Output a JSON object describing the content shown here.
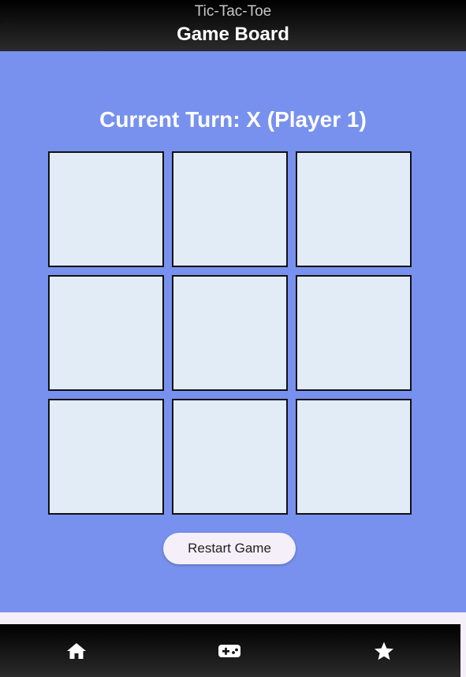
{
  "app_bar": {
    "subtitle": "Tic-Tac-Toe",
    "title": "Game Board"
  },
  "game": {
    "status": "Current Turn: X (Player 1)",
    "board": [
      "",
      "",
      "",
      "",
      "",
      "",
      "",
      "",
      ""
    ],
    "restart_label": "Restart Game"
  },
  "bottom_nav": {
    "items": [
      {
        "icon": "home-icon"
      },
      {
        "icon": "gamepad-icon"
      },
      {
        "icon": "star-icon"
      }
    ]
  },
  "colors": {
    "background": "#7891ee",
    "cell": "#e2ecf6",
    "bar": "#000000",
    "button": "#f4eff8"
  }
}
